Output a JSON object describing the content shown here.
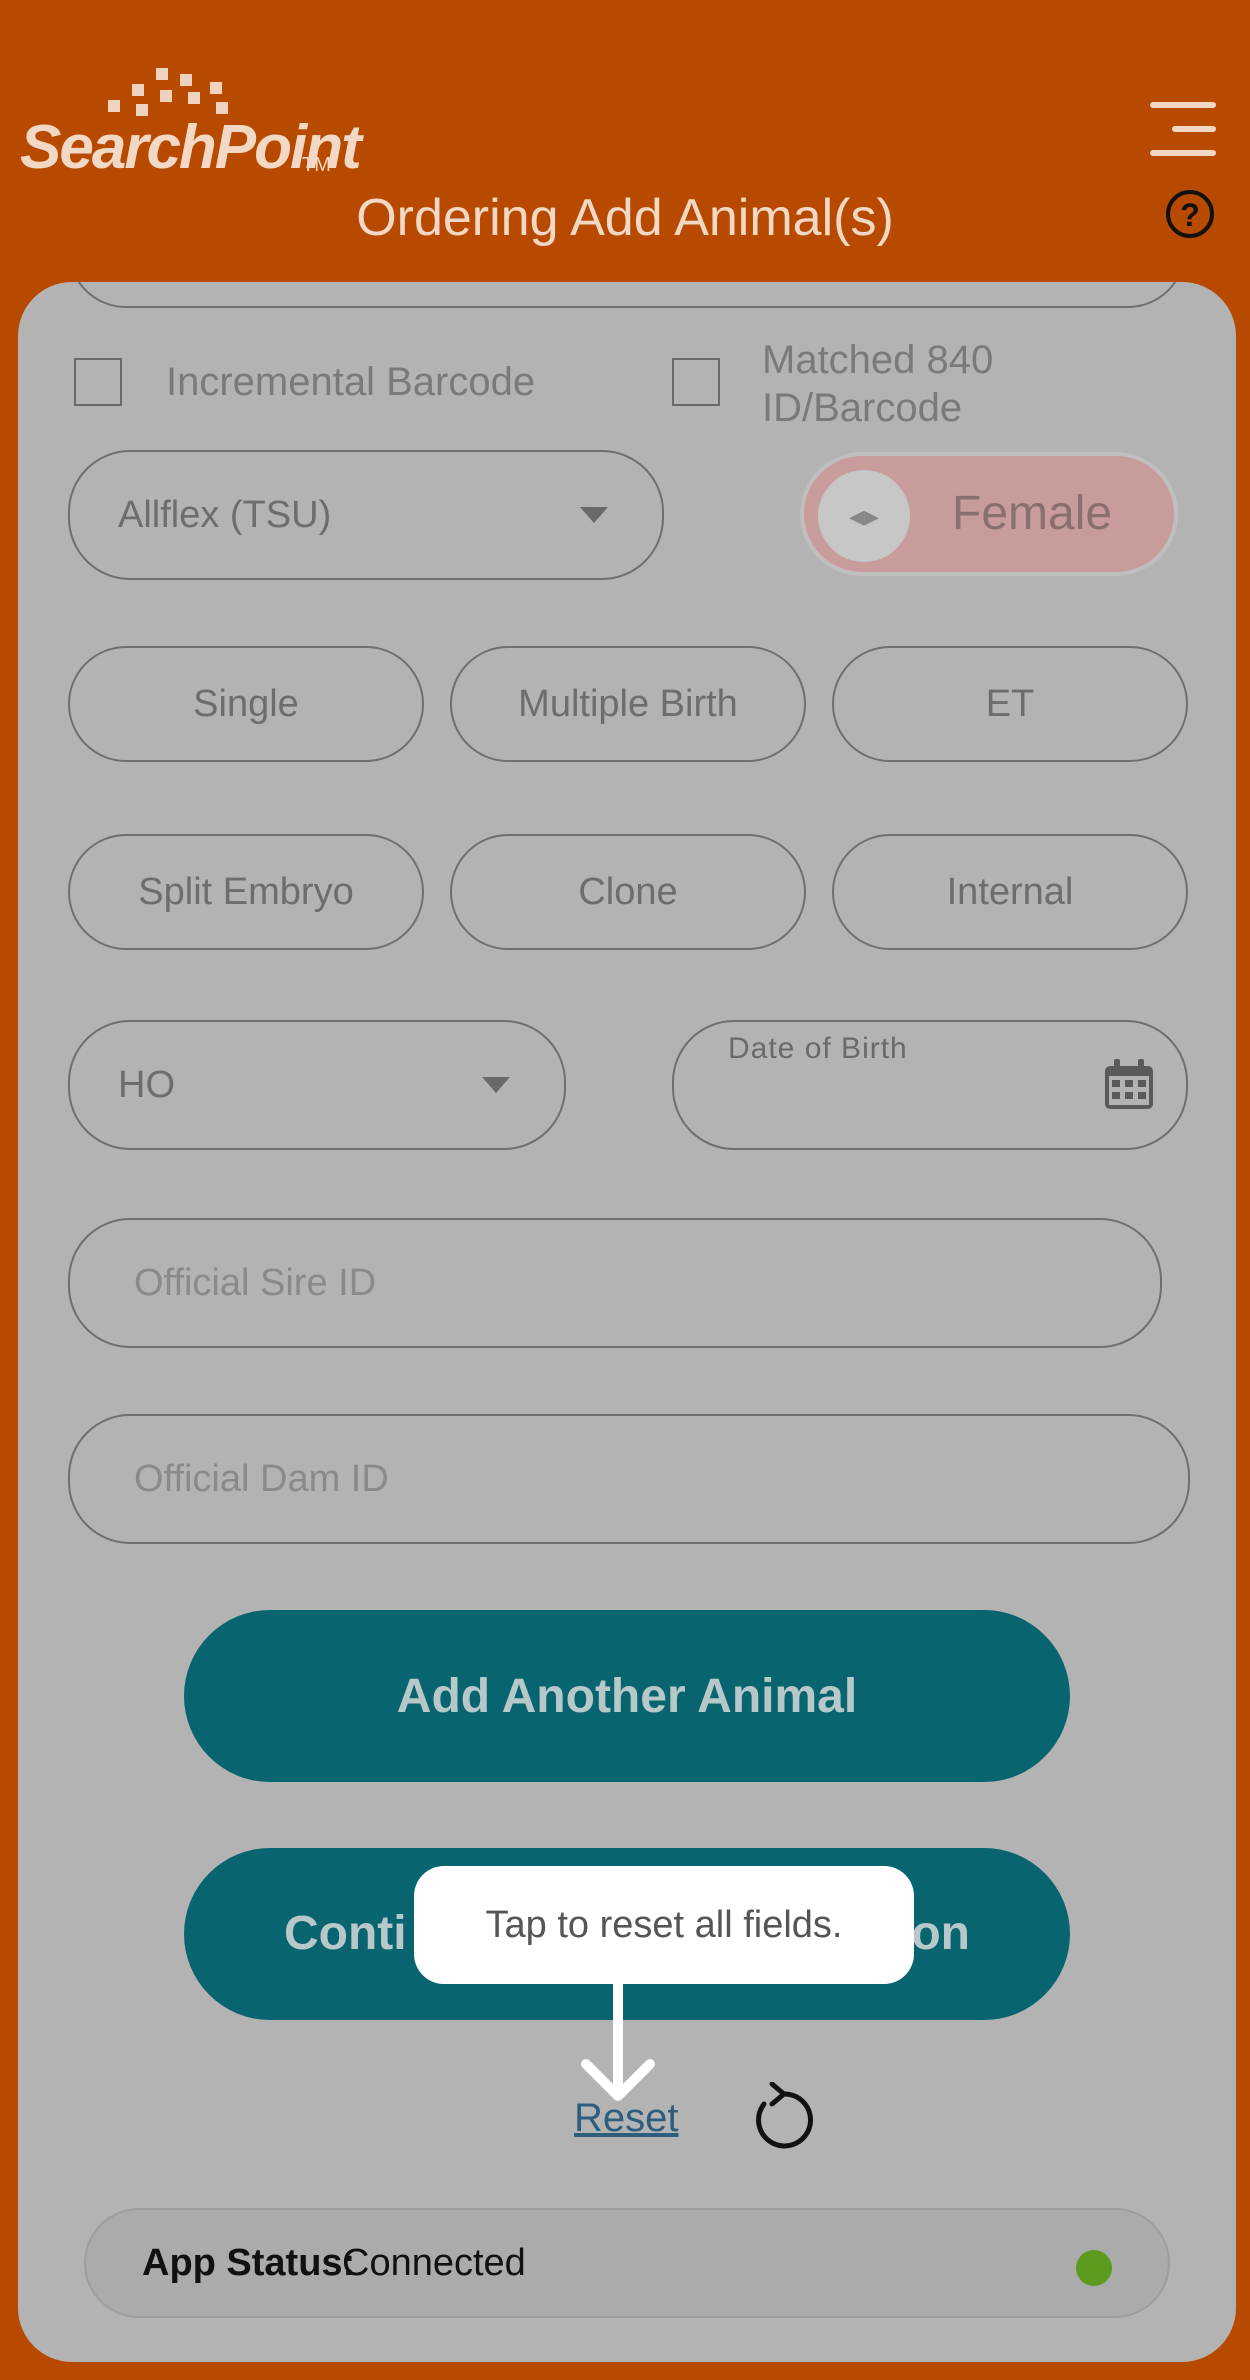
{
  "header": {
    "logo_text": "SearchPoint",
    "logo_tm": "TM",
    "title": "Ordering Add Animal(s)",
    "help_label": "?"
  },
  "form": {
    "incremental_barcode_label": "Incremental Barcode",
    "matched_label_line1": "Matched 840",
    "matched_label_line2": "ID/Barcode",
    "tag_type_value": "Allflex (TSU)",
    "sex_toggle_label": "Female",
    "birth_type_buttons": [
      "Single",
      "Multiple Birth",
      "ET",
      "Split Embryo",
      "Clone",
      "Internal"
    ],
    "breed_value": "HO",
    "dob_label": "Date of Birth",
    "sire_placeholder": "Official Sire ID",
    "dam_placeholder": "Official Dam ID"
  },
  "actions": {
    "add_another": "Add Another Animal",
    "continue_left": "Conti",
    "continue_right": "on",
    "reset_label": "Reset"
  },
  "tooltip": {
    "text": "Tap to reset all fields."
  },
  "status": {
    "label": "App Status:",
    "value": "Connected",
    "dot_color": "#5d9b1e"
  },
  "colors": {
    "brand_orange": "#b84a00",
    "primary_teal": "#08646f"
  }
}
